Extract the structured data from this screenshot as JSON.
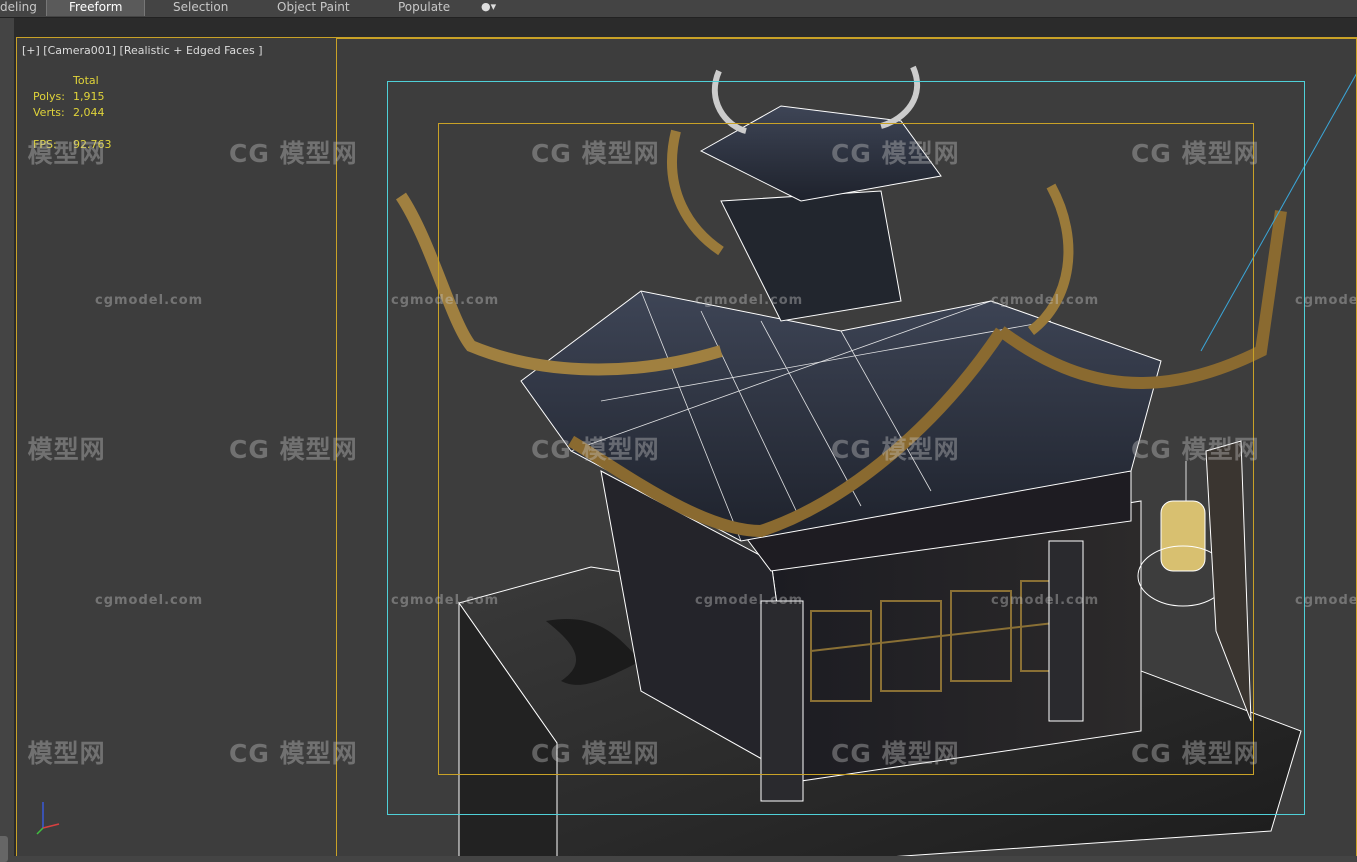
{
  "ribbon": {
    "tabs": [
      {
        "label": "deling"
      },
      {
        "label": "Freeform"
      },
      {
        "label": "Selection"
      },
      {
        "label": "Object Paint"
      },
      {
        "label": "Populate"
      }
    ],
    "dropdown_icon": "options-icon"
  },
  "viewport": {
    "label": "[+] [Camera001] [Realistic + Edged Faces ]",
    "stats": {
      "header": "Total",
      "polys_label": "Polys:",
      "polys_value": "1,915",
      "verts_label": "Verts:",
      "verts_value": "2,044",
      "fps_label": "FPS:",
      "fps_value": "92.763"
    },
    "frame_colors": {
      "safe_frame_outer": "#c9a227",
      "safe_frame_action": "#4fd0d8",
      "safe_frame_title": "#c9a227"
    }
  },
  "watermarks": {
    "cn": "模型网",
    "cn_logo": "CG",
    "en": "cgmodel.com"
  },
  "colors": {
    "viewport_bg": "#3d3d3d",
    "ribbon_bg": "#444444",
    "stats_text": "#e0d43a"
  }
}
